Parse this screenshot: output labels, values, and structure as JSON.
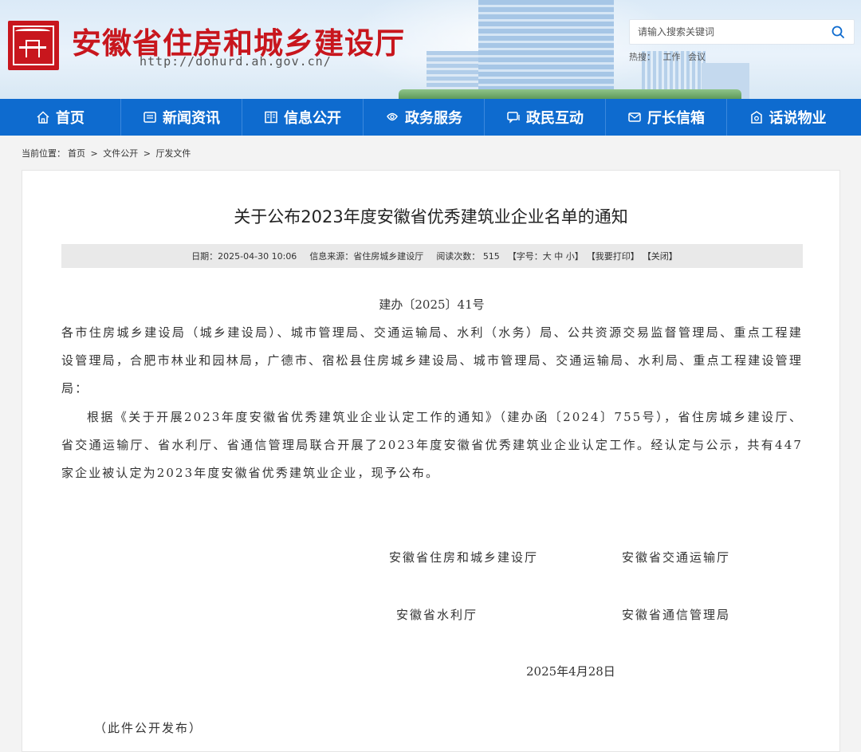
{
  "header": {
    "site_title": "安徽省住房和城乡建设厅",
    "site_url": "http://dohurd.ah.gov.cn/",
    "search_placeholder": "请输入搜索关键词",
    "hot_label": "热搜：",
    "hot_words": [
      "工作",
      "会议"
    ],
    "colors": {
      "brand_red": "#c8161d",
      "nav_blue": "#0e6bcf"
    }
  },
  "nav": {
    "items": [
      {
        "label": "首页",
        "icon": "home-icon"
      },
      {
        "label": "新闻资讯",
        "icon": "news-icon"
      },
      {
        "label": "信息公开",
        "icon": "book-icon"
      },
      {
        "label": "政务服务",
        "icon": "service-icon"
      },
      {
        "label": "政民互动",
        "icon": "chat-icon"
      },
      {
        "label": "厅长信箱",
        "icon": "mailbox-icon"
      },
      {
        "label": "话说物业",
        "icon": "building-gear-icon"
      }
    ]
  },
  "breadcrumb": {
    "prefix": "当前位置：",
    "items": [
      "首页",
      "文件公开",
      "厅发文件"
    ],
    "separator": ">"
  },
  "article": {
    "title": "关于公布2023年度安徽省优秀建筑业企业名单的通知",
    "meta": {
      "date": "日期：2025-04-30 10:06",
      "source": "信息来源：省住房城乡建设厅",
      "views_label": "阅读次数：",
      "views": "515",
      "font_size": "【字号：大 中 小】",
      "print": "【我要打印】",
      "close": "【关闭】"
    },
    "doc_number": "建办〔2025〕41号",
    "addressees": "各市住房城乡建设局（城乡建设局）、城市管理局、交通运输局、水利（水务）局、公共资源交易监督管理局、重点工程建设管理局，合肥市林业和园林局，广德市、宿松县住房城乡建设局、城市管理局、交通运输局、水利局、重点工程建设管理局：",
    "body": "根据《关于开展2023年度安徽省优秀建筑业企业认定工作的通知》（建办函〔2024〕755号），省住房城乡建设厅、省交通运输厅、省水利厅、省通信管理局联合开展了2023年度安徽省优秀建筑业企业认定工作。经认定与公示，共有447家企业被认定为2023年度安徽省优秀建筑业企业，现予公布。",
    "signatories": [
      "安徽省住房和城乡建设厅",
      "安徽省交通运输厅",
      "安徽省水利厅",
      "安徽省通信管理局"
    ],
    "sign_date": "2025年4月28日",
    "closing_note": "（此件公开发布）"
  }
}
